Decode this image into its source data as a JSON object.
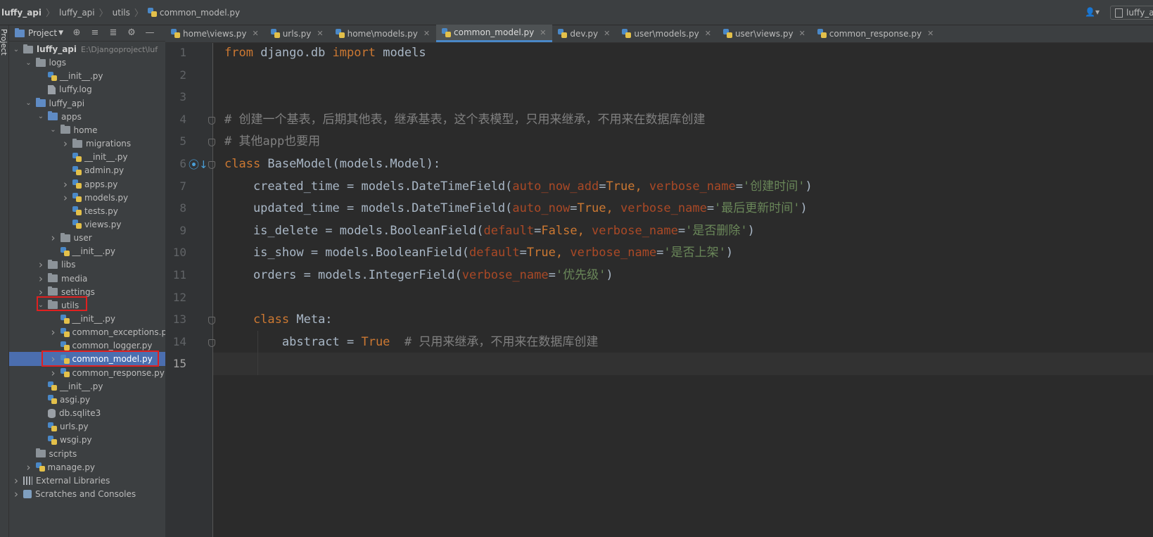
{
  "breadcrumb": [
    "luffy_api",
    "luffy_api",
    "utils",
    "common_model.py"
  ],
  "topbar": {
    "user_icon": "user-icon",
    "right_button": "luffy_a"
  },
  "left_stripe": {
    "label": "Project"
  },
  "project_panel": {
    "title": "Project",
    "toolbar_icons": [
      "locate-icon",
      "expand-all-icon",
      "collapse-all-icon",
      "gear-icon",
      "minimize-icon"
    ]
  },
  "tree": [
    {
      "label": "luffy_api",
      "hint": "E:\\Djangoproject\\luf",
      "depth": 0,
      "arrow": "open",
      "icon": "folder"
    },
    {
      "label": "logs",
      "depth": 1,
      "arrow": "open",
      "icon": "folder"
    },
    {
      "label": "__init__.py",
      "depth": 2,
      "arrow": "",
      "icon": "py"
    },
    {
      "label": "luffy.log",
      "depth": 2,
      "arrow": "",
      "icon": "file"
    },
    {
      "label": "luffy_api",
      "depth": 1,
      "arrow": "open",
      "icon": "folder-blue"
    },
    {
      "label": "apps",
      "depth": 2,
      "arrow": "open",
      "icon": "folder-blue"
    },
    {
      "label": "home",
      "depth": 3,
      "arrow": "open",
      "icon": "folder"
    },
    {
      "label": "migrations",
      "depth": 4,
      "arrow": "closed",
      "icon": "folder"
    },
    {
      "label": "__init__.py",
      "depth": 4,
      "arrow": "",
      "icon": "py"
    },
    {
      "label": "admin.py",
      "depth": 4,
      "arrow": "",
      "icon": "py"
    },
    {
      "label": "apps.py",
      "depth": 4,
      "arrow": "closed",
      "icon": "py"
    },
    {
      "label": "models.py",
      "depth": 4,
      "arrow": "closed",
      "icon": "py"
    },
    {
      "label": "tests.py",
      "depth": 4,
      "arrow": "",
      "icon": "py"
    },
    {
      "label": "views.py",
      "depth": 4,
      "arrow": "",
      "icon": "py"
    },
    {
      "label": "user",
      "depth": 3,
      "arrow": "closed",
      "icon": "folder"
    },
    {
      "label": "__init__.py",
      "depth": 3,
      "arrow": "",
      "icon": "py"
    },
    {
      "label": "libs",
      "depth": 2,
      "arrow": "closed",
      "icon": "folder"
    },
    {
      "label": "media",
      "depth": 2,
      "arrow": "closed",
      "icon": "folder"
    },
    {
      "label": "settings",
      "depth": 2,
      "arrow": "closed",
      "icon": "folder"
    },
    {
      "label": "utils",
      "depth": 2,
      "arrow": "open",
      "icon": "folder"
    },
    {
      "label": "__init__.py",
      "depth": 3,
      "arrow": "",
      "icon": "py"
    },
    {
      "label": "common_exceptions.py",
      "depth": 3,
      "arrow": "closed",
      "icon": "py"
    },
    {
      "label": "common_logger.py",
      "depth": 3,
      "arrow": "",
      "icon": "py"
    },
    {
      "label": "common_model.py",
      "depth": 3,
      "arrow": "closed",
      "icon": "py",
      "selected": true
    },
    {
      "label": "common_response.py",
      "depth": 3,
      "arrow": "closed",
      "icon": "py"
    },
    {
      "label": "__init__.py",
      "depth": 2,
      "arrow": "",
      "icon": "py"
    },
    {
      "label": "asgi.py",
      "depth": 2,
      "arrow": "",
      "icon": "py"
    },
    {
      "label": "db.sqlite3",
      "depth": 2,
      "arrow": "",
      "icon": "db"
    },
    {
      "label": "urls.py",
      "depth": 2,
      "arrow": "",
      "icon": "py"
    },
    {
      "label": "wsgi.py",
      "depth": 2,
      "arrow": "",
      "icon": "py"
    },
    {
      "label": "scripts",
      "depth": 1,
      "arrow": "",
      "icon": "folder"
    },
    {
      "label": "manage.py",
      "depth": 1,
      "arrow": "closed",
      "icon": "py"
    },
    {
      "label": "External Libraries",
      "depth": 0,
      "arrow": "closed",
      "icon": "lib"
    },
    {
      "label": "Scratches and Consoles",
      "depth": 0,
      "arrow": "closed",
      "icon": "scratch"
    }
  ],
  "tabs": [
    {
      "label": "home\\views.py",
      "active": false
    },
    {
      "label": "urls.py",
      "active": false
    },
    {
      "label": "home\\models.py",
      "active": false
    },
    {
      "label": "common_model.py",
      "active": true
    },
    {
      "label": "dev.py",
      "active": false
    },
    {
      "label": "user\\models.py",
      "active": false
    },
    {
      "label": "user\\views.py",
      "active": false
    },
    {
      "label": "common_response.py",
      "active": false
    }
  ],
  "editor": {
    "current_line": 15,
    "lines": [
      [
        [
          "kw",
          "from"
        ],
        [
          "nm",
          " django.db "
        ],
        [
          "kw",
          "import"
        ],
        [
          "nm",
          " models"
        ]
      ],
      [],
      [],
      [
        [
          "cm",
          "# 创建一个基表，后期其他表，继承基表，这个表模型，只用来继承，不用来在数据库创建"
        ]
      ],
      [
        [
          "cm",
          "# 其他app也要用"
        ]
      ],
      [
        [
          "kw",
          "class"
        ],
        [
          "nm",
          " BaseModel(models.Model):"
        ]
      ],
      [
        [
          "nm",
          "    created_time = models.DateTimeField("
        ],
        [
          "kwarg",
          "auto_now_add"
        ],
        [
          "nm",
          "="
        ],
        [
          "bool",
          "True"
        ],
        [
          "kw",
          ", "
        ],
        [
          "kwarg",
          "verbose_name"
        ],
        [
          "nm",
          "="
        ],
        [
          "str",
          "'创建时间'"
        ],
        [
          "nm",
          ")"
        ]
      ],
      [
        [
          "nm",
          "    updated_time = models.DateTimeField("
        ],
        [
          "kwarg",
          "auto_now"
        ],
        [
          "nm",
          "="
        ],
        [
          "bool",
          "True"
        ],
        [
          "kw",
          ", "
        ],
        [
          "kwarg",
          "verbose_name"
        ],
        [
          "nm",
          "="
        ],
        [
          "str",
          "'最后更新时间'"
        ],
        [
          "nm",
          ")"
        ]
      ],
      [
        [
          "nm",
          "    is_delete = models.BooleanField("
        ],
        [
          "kwarg",
          "default"
        ],
        [
          "nm",
          "="
        ],
        [
          "bool",
          "False"
        ],
        [
          "kw",
          ", "
        ],
        [
          "kwarg",
          "verbose_name"
        ],
        [
          "nm",
          "="
        ],
        [
          "str",
          "'是否删除'"
        ],
        [
          "nm",
          ")"
        ]
      ],
      [
        [
          "nm",
          "    is_show = models.BooleanField("
        ],
        [
          "kwarg",
          "default"
        ],
        [
          "nm",
          "="
        ],
        [
          "bool",
          "True"
        ],
        [
          "kw",
          ", "
        ],
        [
          "kwarg",
          "verbose_name"
        ],
        [
          "nm",
          "="
        ],
        [
          "str",
          "'是否上架'"
        ],
        [
          "nm",
          ")"
        ]
      ],
      [
        [
          "nm",
          "    orders = models.IntegerField("
        ],
        [
          "kwarg",
          "verbose_name"
        ],
        [
          "nm",
          "="
        ],
        [
          "str",
          "'优先级'"
        ],
        [
          "nm",
          ")"
        ]
      ],
      [],
      [
        [
          "kw",
          "    class"
        ],
        [
          "nm",
          " Meta:"
        ]
      ],
      [
        [
          "nm",
          "        abstract = "
        ],
        [
          "bool",
          "True"
        ],
        [
          "cm",
          "  # 只用来继承，不用来在数据库创建"
        ]
      ],
      []
    ]
  },
  "colors": {
    "keyword": "#cc7832",
    "kwarg": "#aa4926",
    "string": "#6a8759",
    "comment": "#808080",
    "text": "#a9b7c6",
    "selection": "#4b6eaf",
    "highlight_box": "#e02020"
  }
}
